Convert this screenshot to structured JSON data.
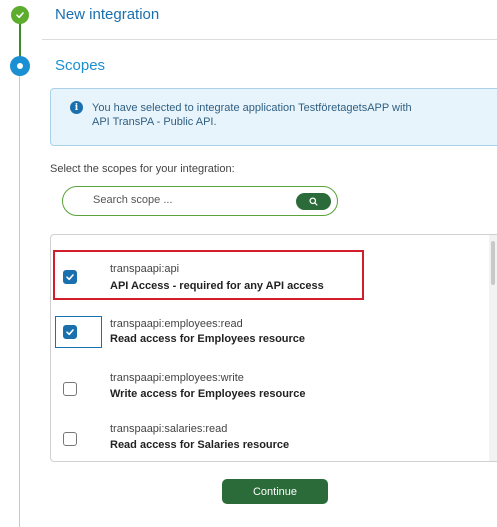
{
  "stepper": {
    "steps": [
      {
        "title": "New integration",
        "state": "completed"
      },
      {
        "title": "Scopes",
        "state": "active"
      }
    ]
  },
  "info": {
    "line1": "You have selected to integrate application TestföretagetsAPP with",
    "line2": "API TransPA - Public API."
  },
  "select_label": "Select the scopes for your integration:",
  "search": {
    "placeholder": "Search scope ..."
  },
  "scopes": [
    {
      "name": "transpaapi:api",
      "description": "API Access - required for any API access",
      "checked": true
    },
    {
      "name": "transpaapi:employees:read",
      "description": "Read access for Employees resource",
      "checked": true
    },
    {
      "name": "transpaapi:employees:write",
      "description": "Write access for Employees resource",
      "checked": false
    },
    {
      "name": "transpaapi:salaries:read",
      "description": "Read access for Salaries resource",
      "checked": false
    }
  ],
  "continue_label": "Continue",
  "colors": {
    "brand_green": "#2b6b3a",
    "step_done": "#5cac2e",
    "accent_blue": "#1a8fd1",
    "highlight_red": "#d21e2a"
  }
}
